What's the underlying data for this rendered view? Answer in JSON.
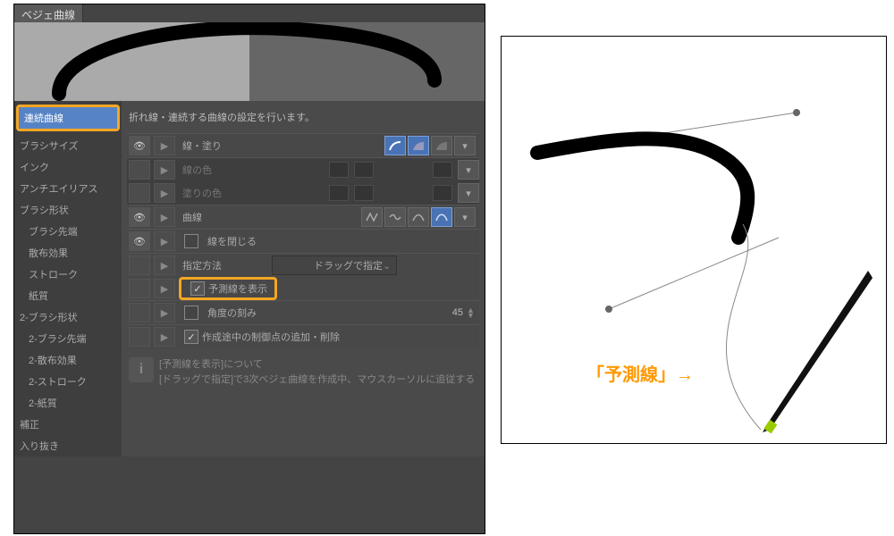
{
  "toolTab": "ベジェ曲線",
  "sidebar": {
    "selected": "連続曲線",
    "items": [
      "ブラシサイズ",
      "インク",
      "アンチエイリアス",
      "ブラシ形状",
      "ブラシ先端",
      "散布効果",
      "ストローク",
      "紙質",
      "2-ブラシ形状",
      "2-ブラシ先端",
      "2-散布効果",
      "2-ストローク",
      "2-紙質",
      "補正",
      "入り抜き"
    ]
  },
  "description": "折れ線・連続する曲線の設定を行います。",
  "rows": {
    "lineFill": "線・塗り",
    "lineColor": "線の色",
    "fillColor": "塗りの色",
    "curve": "曲線",
    "closeLine": "線を閉じる",
    "method": "指定方法",
    "methodValue": "ドラッグで指定",
    "showPrediction": "予測線を表示",
    "angleStep": "角度の刻み",
    "angleStepValue": "45",
    "addRemove": "作成途中の制御点の追加・削除"
  },
  "info": {
    "title": "[予測線を表示]について",
    "body": "[ドラッグで指定]で3次ベジェ曲線を作成中、マウスカーソルに追従する"
  },
  "annotation": {
    "text": "「予測線」→"
  },
  "colors": {
    "highlight": "#f5a623",
    "selection": "#5683c6",
    "shapeActive": "#4a73b5"
  }
}
